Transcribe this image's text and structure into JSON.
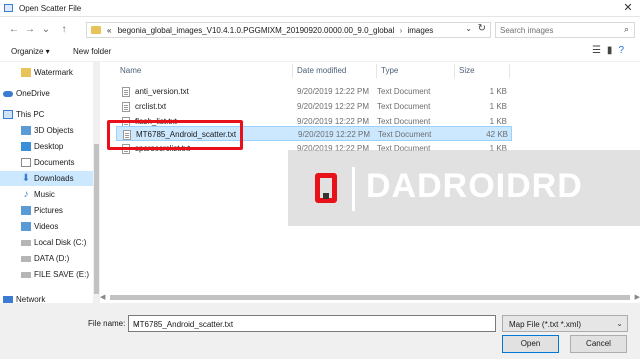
{
  "window": {
    "title": "Open Scatter File",
    "close_glyph": "✕"
  },
  "nav": {
    "back": "←",
    "forward": "→",
    "recent": "⌄",
    "up": "↑"
  },
  "address": {
    "lead": "«",
    "crumbs": [
      "begonia_global_images_V10.4.1.0.PGGMIXM_20190920.0000.00_9.0_global",
      "images"
    ],
    "separator": "›"
  },
  "search": {
    "placeholder": "Search images"
  },
  "toolbar": {
    "organize": "Organize ▾",
    "new_folder": "New folder"
  },
  "sidebar": {
    "items": [
      {
        "label": "Watermark",
        "icon": "folder-icon",
        "color": "#e8c35a"
      },
      {
        "label": "OneDrive",
        "icon": "cloud-icon",
        "color": "#3b7bd1"
      },
      {
        "label": "This PC",
        "icon": "computer-icon",
        "color": "#3b7bd1"
      },
      {
        "label": "3D Objects",
        "icon": "cube-icon",
        "color": "#5b9bd5"
      },
      {
        "label": "Desktop",
        "icon": "desktop-icon",
        "color": "#3b8fd9"
      },
      {
        "label": "Documents",
        "icon": "documents-icon",
        "color": "#8a8a8a"
      },
      {
        "label": "Downloads",
        "icon": "download-icon",
        "color": "#3b7bd1",
        "selected": true
      },
      {
        "label": "Music",
        "icon": "music-icon",
        "color": "#3b7bd1"
      },
      {
        "label": "Pictures",
        "icon": "pictures-icon",
        "color": "#5b9bd5"
      },
      {
        "label": "Videos",
        "icon": "videos-icon",
        "color": "#5b9bd5"
      },
      {
        "label": "Local Disk (C:)",
        "icon": "drive-icon",
        "color": "#777777"
      },
      {
        "label": "DATA (D:)",
        "icon": "drive-icon",
        "color": "#777777"
      },
      {
        "label": "FILE SAVE (E:)",
        "icon": "drive-icon",
        "color": "#777777"
      },
      {
        "label": "Network",
        "icon": "network-icon",
        "color": "#3b7bd1"
      }
    ]
  },
  "columns": {
    "name": "Name",
    "date": "Date modified",
    "type": "Type",
    "size": "Size"
  },
  "files": [
    {
      "name": "anti_version.txt",
      "date": "9/20/2019 12:22 PM",
      "type": "Text Document",
      "size": "1 KB"
    },
    {
      "name": "crclist.txt",
      "date": "9/20/2019 12:22 PM",
      "type": "Text Document",
      "size": "1 KB"
    },
    {
      "name": "flash_list.txt",
      "date": "9/20/2019 12:22 PM",
      "type": "Text Document",
      "size": "1 KB"
    },
    {
      "name": "MT6785_Android_scatter.txt",
      "date": "9/20/2019 12:22 PM",
      "type": "Text Document",
      "size": "42 KB",
      "selected": true
    },
    {
      "name": "sparsecrclist.txt",
      "date": "9/20/2019 12:22 PM",
      "type": "Text Document",
      "size": "1 KB"
    }
  ],
  "watermark": {
    "text": "DADROIDRD"
  },
  "bottom": {
    "filename_label": "File name:",
    "filename_value": "MT6785_Android_scatter.txt",
    "filter": "Map File (*.txt *.xml)",
    "open": "Open",
    "cancel": "Cancel"
  },
  "colors": {
    "selection": "#cce8ff",
    "highlight_box": "#e8111a"
  }
}
